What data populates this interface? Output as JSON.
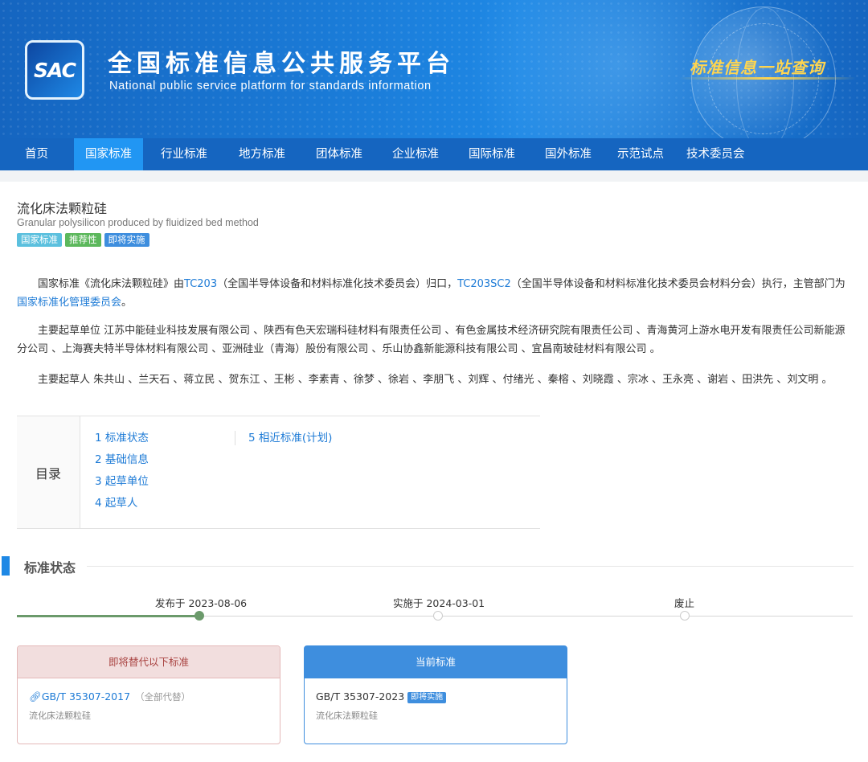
{
  "header": {
    "logo_text": "SAC",
    "title": "全国标准信息公共服务平台",
    "subtitle": "National public service platform  for standards information",
    "slogan": "标准信息一站查询"
  },
  "nav": {
    "items": [
      "首页",
      "国家标准",
      "行业标准",
      "地方标准",
      "团体标准",
      "企业标准",
      "国际标准",
      "国外标准",
      "示范试点",
      "技术委员会"
    ],
    "active_index": 1
  },
  "standard": {
    "title": "流化床法颗粒硅",
    "title_en": "Granular polysilicon produced by fluidized bed method",
    "tags": [
      {
        "label": "国家标准",
        "color": "#5bc0de"
      },
      {
        "label": "推荐性",
        "color": "#5cb85c"
      },
      {
        "label": "即将实施",
        "color": "#3e8ede"
      }
    ]
  },
  "intro": {
    "p1_a": "国家标准《流化床法颗粒硅》由",
    "tc1": "TC203",
    "p1_b": "（全国半导体设备和材料标准化技术委员会）归口，",
    "tc2": "TC203SC2",
    "p1_c": "（全国半导体设备和材料标准化技术委员会材料分会）执行，主管部门为",
    "authority": "国家标准化管理委员会",
    "p1_d": "。",
    "p2": "主要起草单位 江苏中能硅业科技发展有限公司 、陕西有色天宏瑞科硅材料有限责任公司 、有色金属技术经济研究院有限责任公司 、青海黄河上游水电开发有限责任公司新能源分公司 、上海赛夫特半导体材料有限公司 、亚洲硅业（青海）股份有限公司 、乐山协鑫新能源科技有限公司 、宜昌南玻硅材料有限公司 。",
    "p3": "主要起草人 朱共山 、兰天石 、蒋立民 、贺东江 、王彬 、李素青 、徐梦 、徐岩 、李朋飞 、刘辉 、付绪光 、秦榕 、刘晓霞 、宗冰 、王永亮 、谢岩 、田洪先 、刘文明 。"
  },
  "toc": {
    "label": "目录",
    "col1": [
      "1  标准状态",
      "2  基础信息",
      "3  起草单位",
      "4  起草人"
    ],
    "col2": [
      "5  相近标准(计划)"
    ]
  },
  "status": {
    "section_title": "标准状态",
    "timeline": [
      {
        "label": "发布于 2023-08-06",
        "done": true
      },
      {
        "label": "实施于 2024-03-01",
        "done": false
      },
      {
        "label": "废止",
        "done": false
      }
    ]
  },
  "replace_box": {
    "header": "即将替代以下标准",
    "code": "GB/T 35307-2017",
    "note": "（全部代替）",
    "name": "流化床法颗粒硅",
    "header_bg": "#f2dede",
    "header_color": "#a94442",
    "border": "#e4b9b9"
  },
  "current_box": {
    "header": "当前标准",
    "code": "GB/T 35307-2023",
    "badge": "即将实施",
    "name": "流化床法颗粒硅",
    "header_bg": "#3e8ede",
    "border": "#3e8ede"
  }
}
